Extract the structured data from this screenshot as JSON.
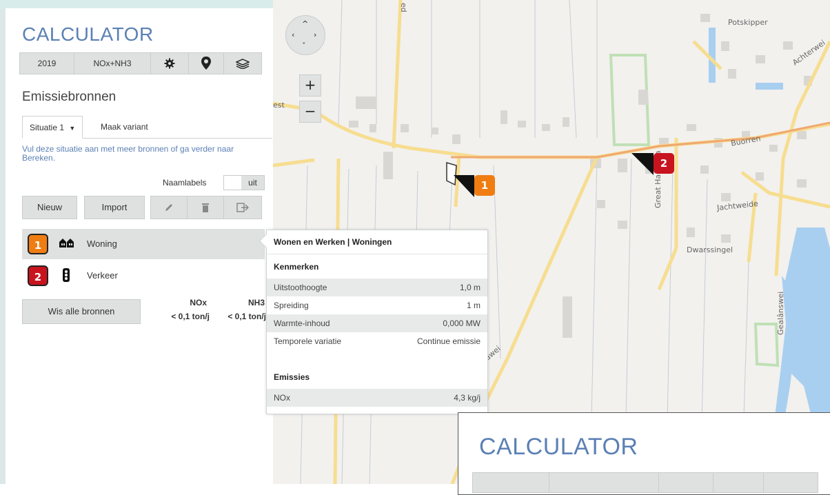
{
  "app": {
    "title": "CALCULATOR"
  },
  "toolbar": {
    "year": "2019",
    "substance": "NOx+NH3",
    "settings_icon": "gear-icon",
    "marker_icon": "map-pin-icon",
    "layers_icon": "layers-icon"
  },
  "section": {
    "title": "Emissiebronnen"
  },
  "tabs": {
    "situatie": "Situatie 1",
    "variant": "Maak variant"
  },
  "help_text": "Vul deze situatie aan met meer bronnen of ga verder naar Bereken.",
  "naamlabels": {
    "label": "Naamlabels",
    "toggle_value": "uit"
  },
  "actions": {
    "new": "Nieuw",
    "import": "Import",
    "edit_icon": "pencil-icon",
    "delete_icon": "trash-icon",
    "export_icon": "export-icon"
  },
  "sources": [
    {
      "number": "1",
      "name": "Woning",
      "color": "#f07d12",
      "icon": "houses-icon"
    },
    {
      "number": "2",
      "name": "Verkeer",
      "color": "#c8141e",
      "icon": "traffic-light-icon"
    }
  ],
  "clear_button": "Wis alle bronnen",
  "totals": {
    "nox_label": "NOx",
    "nh3_label": "NH3",
    "nox_value": "< 0,1 ton/j",
    "nh3_value": "< 0,1 ton/j"
  },
  "popup": {
    "title": "Wonen en Werken | Woningen",
    "kenmerken_title": "Kenmerken",
    "kenmerken": [
      {
        "label": "Uitstoothoogte",
        "value": "1,0 m"
      },
      {
        "label": "Spreiding",
        "value": "1 m"
      },
      {
        "label": "Warmte-inhoud",
        "value": "0,000 MW"
      },
      {
        "label": "Temporele variatie",
        "value": "Continue emissie"
      }
    ],
    "emissies_title": "Emissies",
    "emissies": [
      {
        "label": "NOx",
        "value": "4,3 kg/j"
      }
    ]
  },
  "map": {
    "labels": [
      "Potskipper",
      "Achterwei",
      "Buorren",
      "Jachtweide",
      "Dwarssingel",
      "Great Haersma",
      "Gealânswei",
      "ed",
      "est",
      "eawei"
    ],
    "zoom_in": "+",
    "zoom_out": "−",
    "markers": [
      "1",
      "2"
    ]
  },
  "overlay": {
    "title": "CALCULATOR"
  },
  "colors": {
    "accent": "#5b80b4",
    "orange": "#f07d12",
    "red": "#c8141e"
  }
}
